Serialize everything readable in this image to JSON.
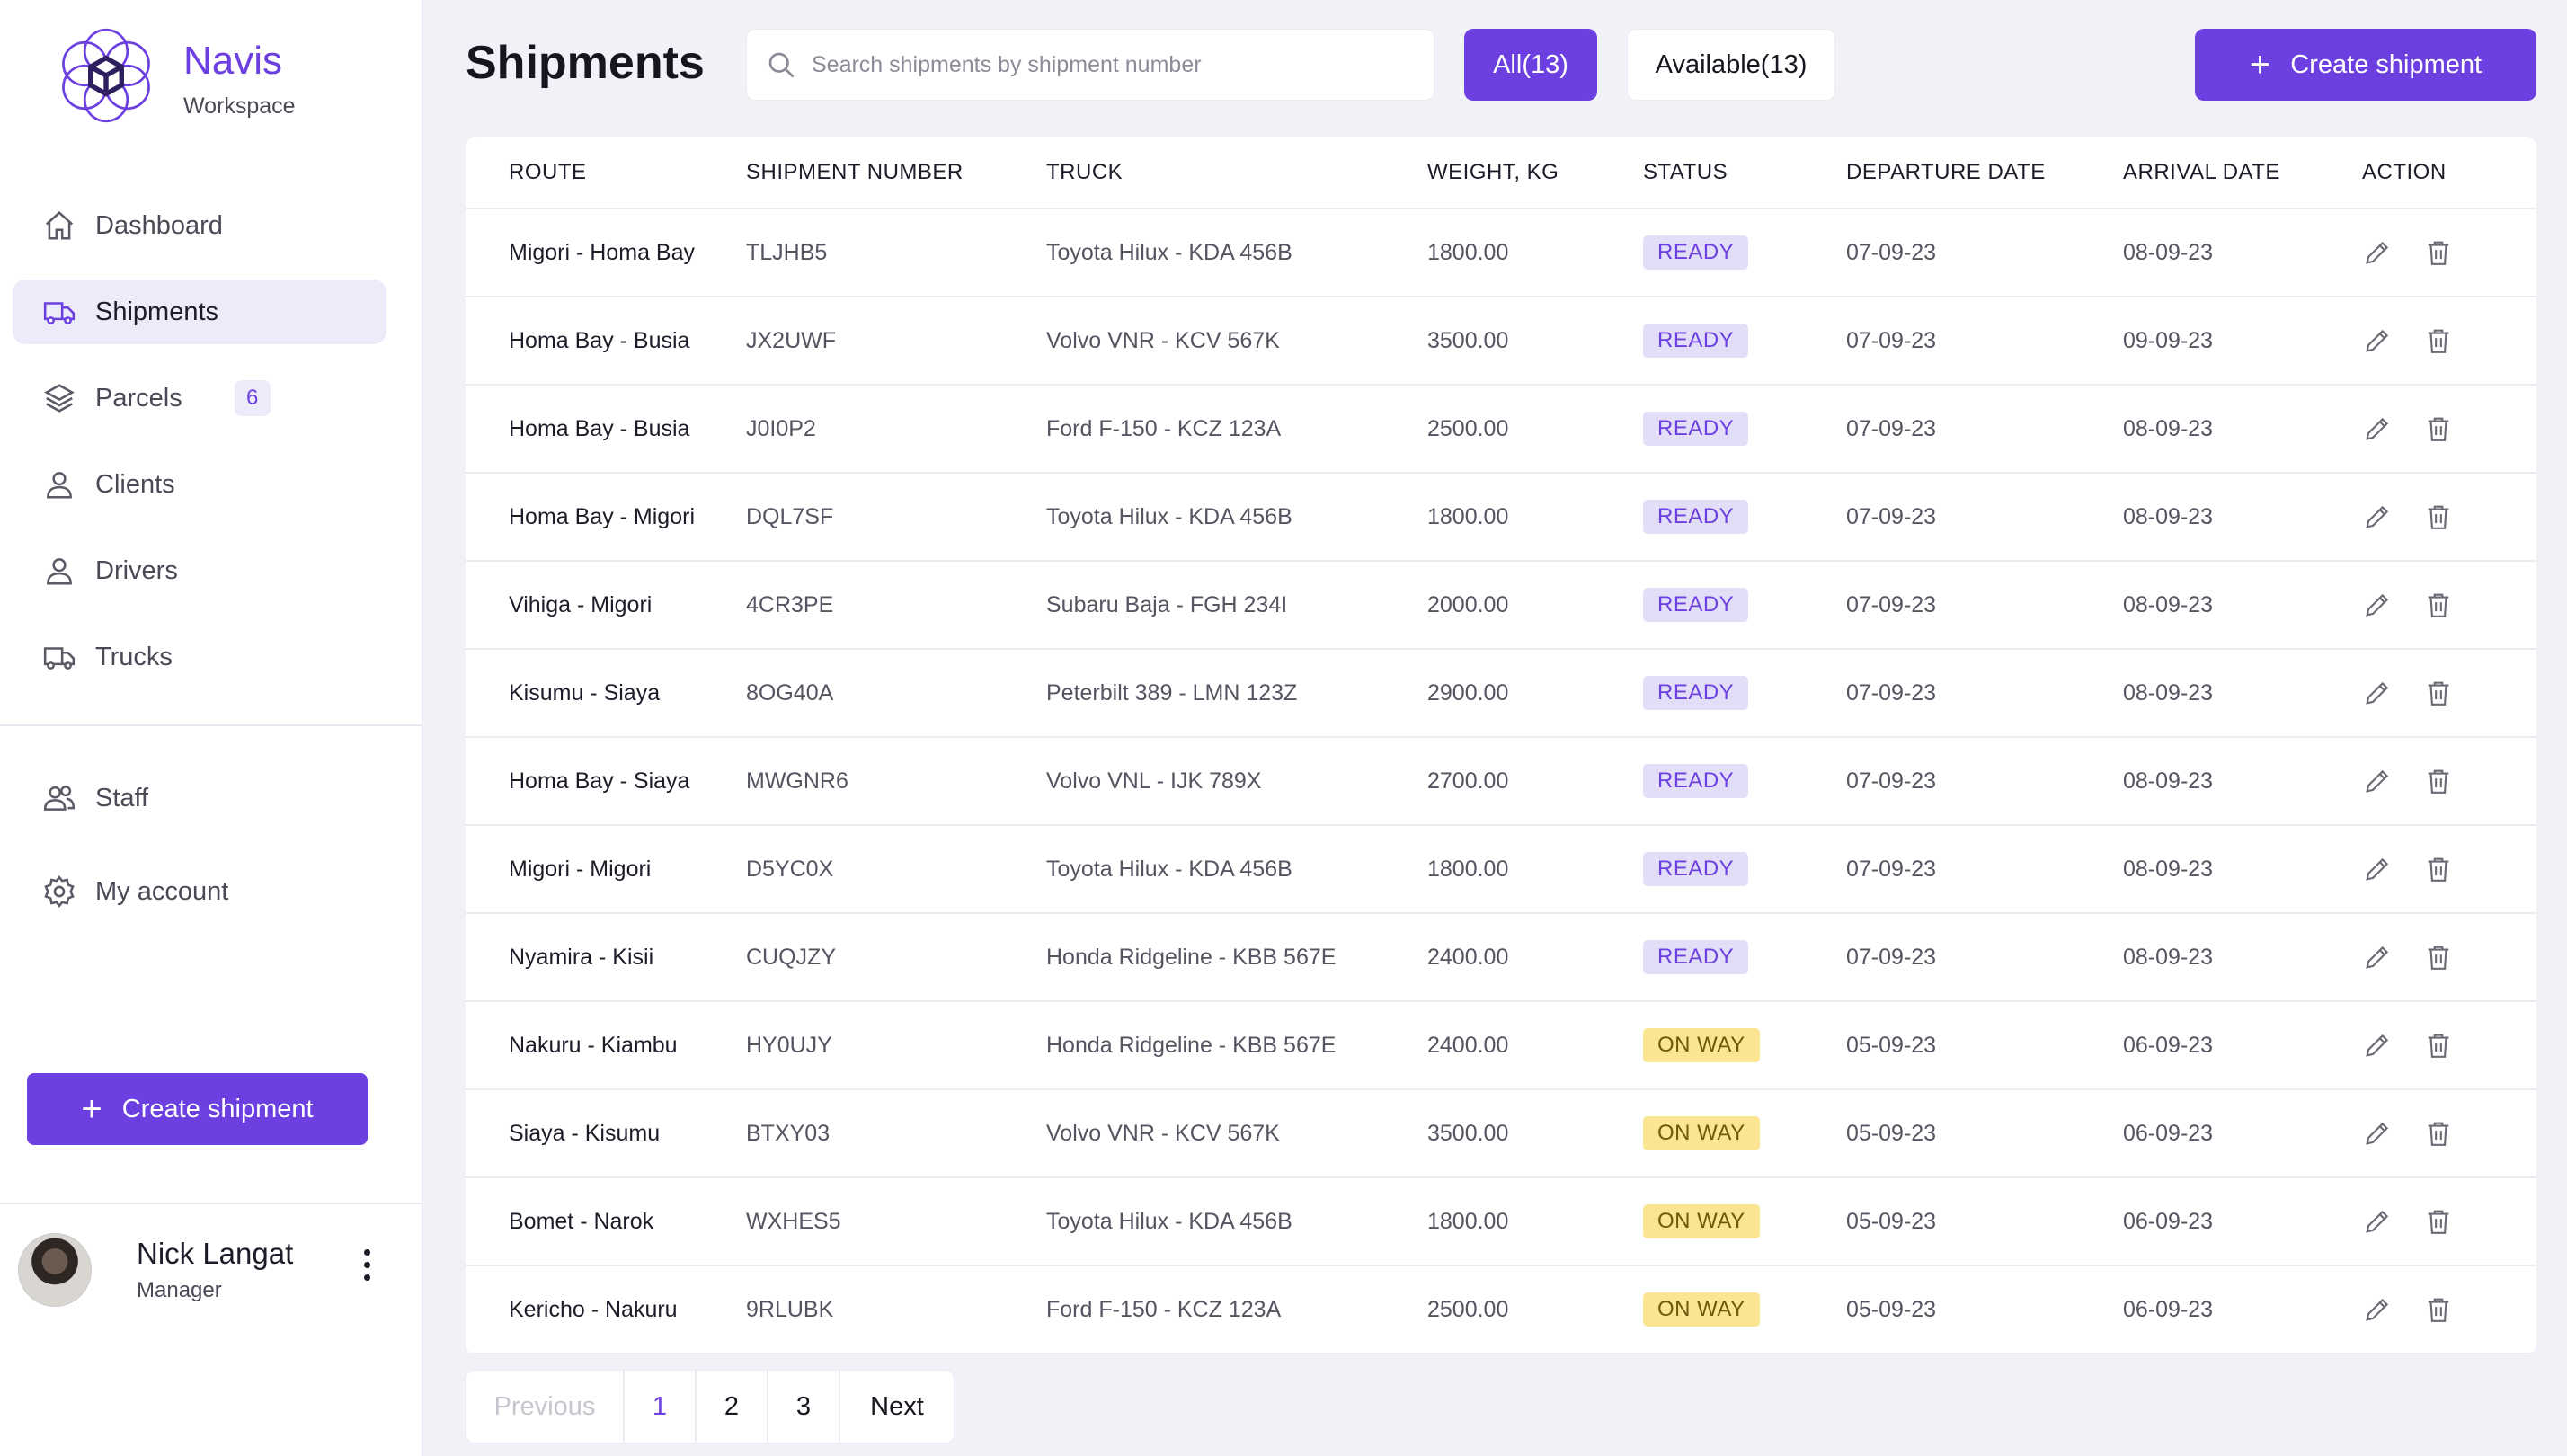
{
  "colors": {
    "accent": "#6c40e0",
    "ready_bg": "#e3def8",
    "onway_bg": "#fbe593"
  },
  "brand": {
    "name": "Navis",
    "subtitle": "Workspace",
    "logo_icon": "cube-network-icon"
  },
  "nav": [
    {
      "label": "Dashboard",
      "icon": "home-icon",
      "active": false
    },
    {
      "label": "Shipments",
      "icon": "truck-icon",
      "active": true
    },
    {
      "label": "Parcels",
      "icon": "layers-icon",
      "active": false,
      "badge": "6"
    },
    {
      "label": "Clients",
      "icon": "user-icon",
      "active": false
    },
    {
      "label": "Drivers",
      "icon": "user-icon",
      "active": false
    },
    {
      "label": "Trucks",
      "icon": "truck-icon",
      "active": false
    }
  ],
  "nav_secondary": [
    {
      "label": "Staff",
      "icon": "users-icon"
    },
    {
      "label": "My account",
      "icon": "gear-icon"
    }
  ],
  "sidebar_create_label": "Create shipment",
  "user": {
    "name": "Nick Langat",
    "role": "Manager"
  },
  "header": {
    "title": "Shipments",
    "search_placeholder": "Search shipments by shipment number",
    "filter_all": "All(13)",
    "filter_available": "Available(13)",
    "create_label": "Create shipment"
  },
  "table": {
    "columns": [
      "ROUTE",
      "SHIPMENT NUMBER",
      "TRUCK",
      "WEIGHT, KG",
      "STATUS",
      "DEPARTURE DATE",
      "ARRIVAL DATE",
      "ACTION"
    ],
    "rows": [
      {
        "route": "Migori - Homa Bay",
        "number": "TLJHB5",
        "truck": "Toyota Hilux - KDA 456B",
        "weight": "1800.00",
        "status": "READY",
        "departure": "07-09-23",
        "arrival": "08-09-23"
      },
      {
        "route": "Homa Bay - Busia",
        "number": "JX2UWF",
        "truck": "Volvo VNR - KCV 567K",
        "weight": "3500.00",
        "status": "READY",
        "departure": "07-09-23",
        "arrival": "09-09-23"
      },
      {
        "route": "Homa Bay - Busia",
        "number": "J0I0P2",
        "truck": "Ford F-150 - KCZ 123A",
        "weight": "2500.00",
        "status": "READY",
        "departure": "07-09-23",
        "arrival": "08-09-23"
      },
      {
        "route": "Homa Bay - Migori",
        "number": "DQL7SF",
        "truck": "Toyota Hilux - KDA 456B",
        "weight": "1800.00",
        "status": "READY",
        "departure": "07-09-23",
        "arrival": "08-09-23"
      },
      {
        "route": "Vihiga - Migori",
        "number": "4CR3PE",
        "truck": "Subaru Baja - FGH 234I",
        "weight": "2000.00",
        "status": "READY",
        "departure": "07-09-23",
        "arrival": "08-09-23"
      },
      {
        "route": "Kisumu - Siaya",
        "number": "8OG40A",
        "truck": "Peterbilt 389 - LMN 123Z",
        "weight": "2900.00",
        "status": "READY",
        "departure": "07-09-23",
        "arrival": "08-09-23"
      },
      {
        "route": "Homa Bay - Siaya",
        "number": "MWGNR6",
        "truck": "Volvo VNL - IJK 789X",
        "weight": "2700.00",
        "status": "READY",
        "departure": "07-09-23",
        "arrival": "08-09-23"
      },
      {
        "route": "Migori - Migori",
        "number": "D5YC0X",
        "truck": "Toyota Hilux - KDA 456B",
        "weight": "1800.00",
        "status": "READY",
        "departure": "07-09-23",
        "arrival": "08-09-23"
      },
      {
        "route": "Nyamira - Kisii",
        "number": "CUQJZY",
        "truck": "Honda Ridgeline - KBB 567E",
        "weight": "2400.00",
        "status": "READY",
        "departure": "07-09-23",
        "arrival": "08-09-23"
      },
      {
        "route": "Nakuru - Kiambu",
        "number": "HY0UJY",
        "truck": "Honda Ridgeline - KBB 567E",
        "weight": "2400.00",
        "status": "ON WAY",
        "departure": "05-09-23",
        "arrival": "06-09-23"
      },
      {
        "route": "Siaya - Kisumu",
        "number": "BTXY03",
        "truck": "Volvo VNR - KCV 567K",
        "weight": "3500.00",
        "status": "ON WAY",
        "departure": "05-09-23",
        "arrival": "06-09-23"
      },
      {
        "route": "Bomet - Narok",
        "number": "WXHES5",
        "truck": "Toyota Hilux - KDA 456B",
        "weight": "1800.00",
        "status": "ON WAY",
        "departure": "05-09-23",
        "arrival": "06-09-23"
      },
      {
        "route": "Kericho - Nakuru",
        "number": "9RLUBK",
        "truck": "Ford F-150 - KCZ 123A",
        "weight": "2500.00",
        "status": "ON WAY",
        "departure": "05-09-23",
        "arrival": "06-09-23"
      }
    ]
  },
  "pagination": {
    "previous": "Previous",
    "pages": [
      "1",
      "2",
      "3"
    ],
    "current": "1",
    "next": "Next"
  }
}
